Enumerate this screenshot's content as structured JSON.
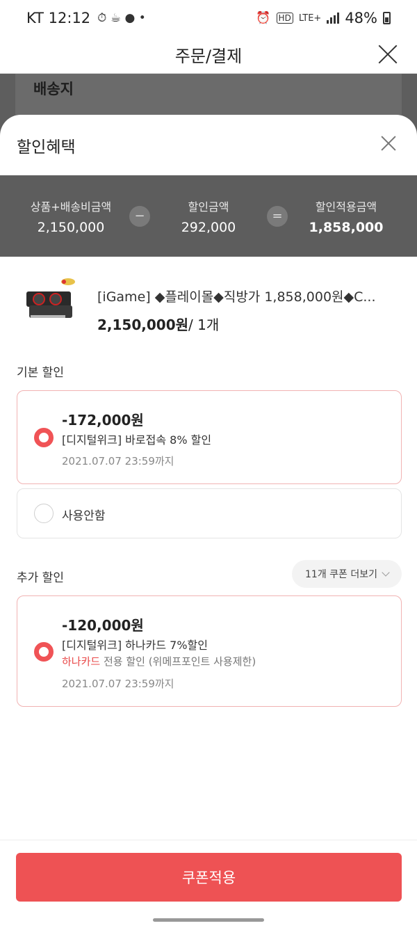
{
  "status_bar": {
    "carrier_time": "KT 12:12",
    "network": "LTE+",
    "hd": "HD",
    "battery": "48%"
  },
  "order_page": {
    "title": "주문/결제",
    "section": "배송지"
  },
  "sheet": {
    "title": "할인혜택",
    "summary": {
      "items_label": "상품+배송비금액",
      "items_value": "2,150,000",
      "minus": "−",
      "discount_label": "할인금액",
      "discount_value": "292,000",
      "equals": "=",
      "final_label": "할인적용금액",
      "final_value": "1,858,000"
    },
    "product": {
      "name": "[iGame] ◆플레이몰◆직방가 1,858,000원◆C...",
      "price": "2,150,000원",
      "qty": "/ 1개"
    },
    "basic_discount": {
      "title": "기본 할인",
      "coupon": {
        "amount": "-172,000원",
        "name": "[디지털위크] 바로접속 8% 할인",
        "expire": "2021.07.07 23:59까지"
      },
      "none_label": "사용안함"
    },
    "extra_discount": {
      "title": "추가 할인",
      "more_label": "11개 쿠폰 더보기",
      "coupon": {
        "amount": "-120,000원",
        "name": "[디지털위크] 하나카드 7%할인",
        "note_highlight": "하나카드",
        "note_rest": " 전용 할인 (위메프포인트 사용제한)",
        "expire": "2021.07.07 23:59까지"
      }
    },
    "apply_label": "쿠폰적용"
  }
}
